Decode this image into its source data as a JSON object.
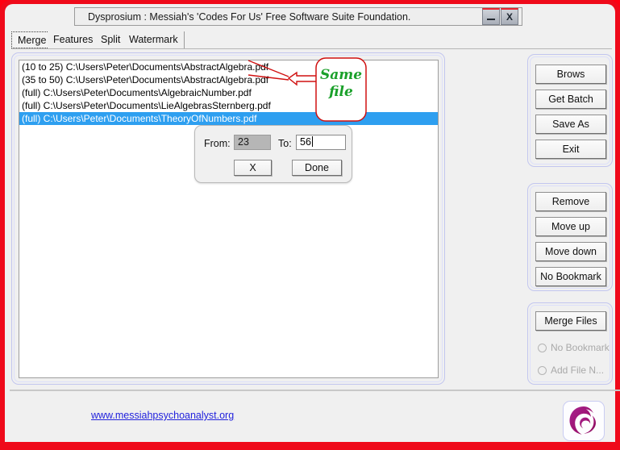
{
  "window": {
    "title": "Dysprosium : Messiah's 'Codes For Us' Free Software Suite Foundation.",
    "minimize_label": "",
    "close_label": "X",
    "accent_red": "#ef0a1a",
    "surface": "#f0f0f0"
  },
  "tabs": [
    {
      "label": "Merge",
      "active": true
    },
    {
      "label": "Features",
      "active": false
    },
    {
      "label": "Split",
      "active": false
    },
    {
      "label": "Watermark",
      "active": false
    }
  ],
  "file_list": {
    "items": [
      {
        "label": "(10 to 25) C:\\Users\\Peter\\Documents\\AbstractAlgebra.pdf",
        "selected": false
      },
      {
        "label": "(35 to 50) C:\\Users\\Peter\\Documents\\AbstractAlgebra.pdf",
        "selected": false
      },
      {
        "label": "(full) C:\\Users\\Peter\\Documents\\AlgebraicNumber.pdf",
        "selected": false
      },
      {
        "label": "(full) C:\\Users\\Peter\\Documents\\LieAlgebrasSternberg.pdf",
        "selected": false
      },
      {
        "label": "(full) C:\\Users\\Peter\\Documents\\TheoryOfNumbers.pdf",
        "selected": true
      }
    ],
    "selection_color": "#2e9ff0"
  },
  "annotation": {
    "line1": "Same",
    "line2": "file",
    "text_color": "#1aa02a",
    "outline_color": "#d01010"
  },
  "range_dialog": {
    "from_label": "From:",
    "from_value": "23",
    "to_label": "To:",
    "to_value": "56",
    "cancel_label": "X",
    "done_label": "Done"
  },
  "side_buttons_group1": [
    {
      "label": "Brows"
    },
    {
      "label": "Get Batch"
    },
    {
      "label": "Save As"
    },
    {
      "label": "Exit"
    }
  ],
  "side_buttons_group2": [
    {
      "label": "Remove"
    },
    {
      "label": "Move up"
    },
    {
      "label": "Move down"
    },
    {
      "label": "No Bookmark"
    }
  ],
  "merge_group": {
    "merge_button": "Merge Files",
    "radios": [
      {
        "label": "No Bookmark",
        "checked": false,
        "disabled": true
      },
      {
        "label": "Add File N...",
        "checked": false,
        "disabled": true
      }
    ]
  },
  "footer": {
    "link": "www.messiahpsychoanalyst.org",
    "logo_name": "phoenix-logo"
  }
}
